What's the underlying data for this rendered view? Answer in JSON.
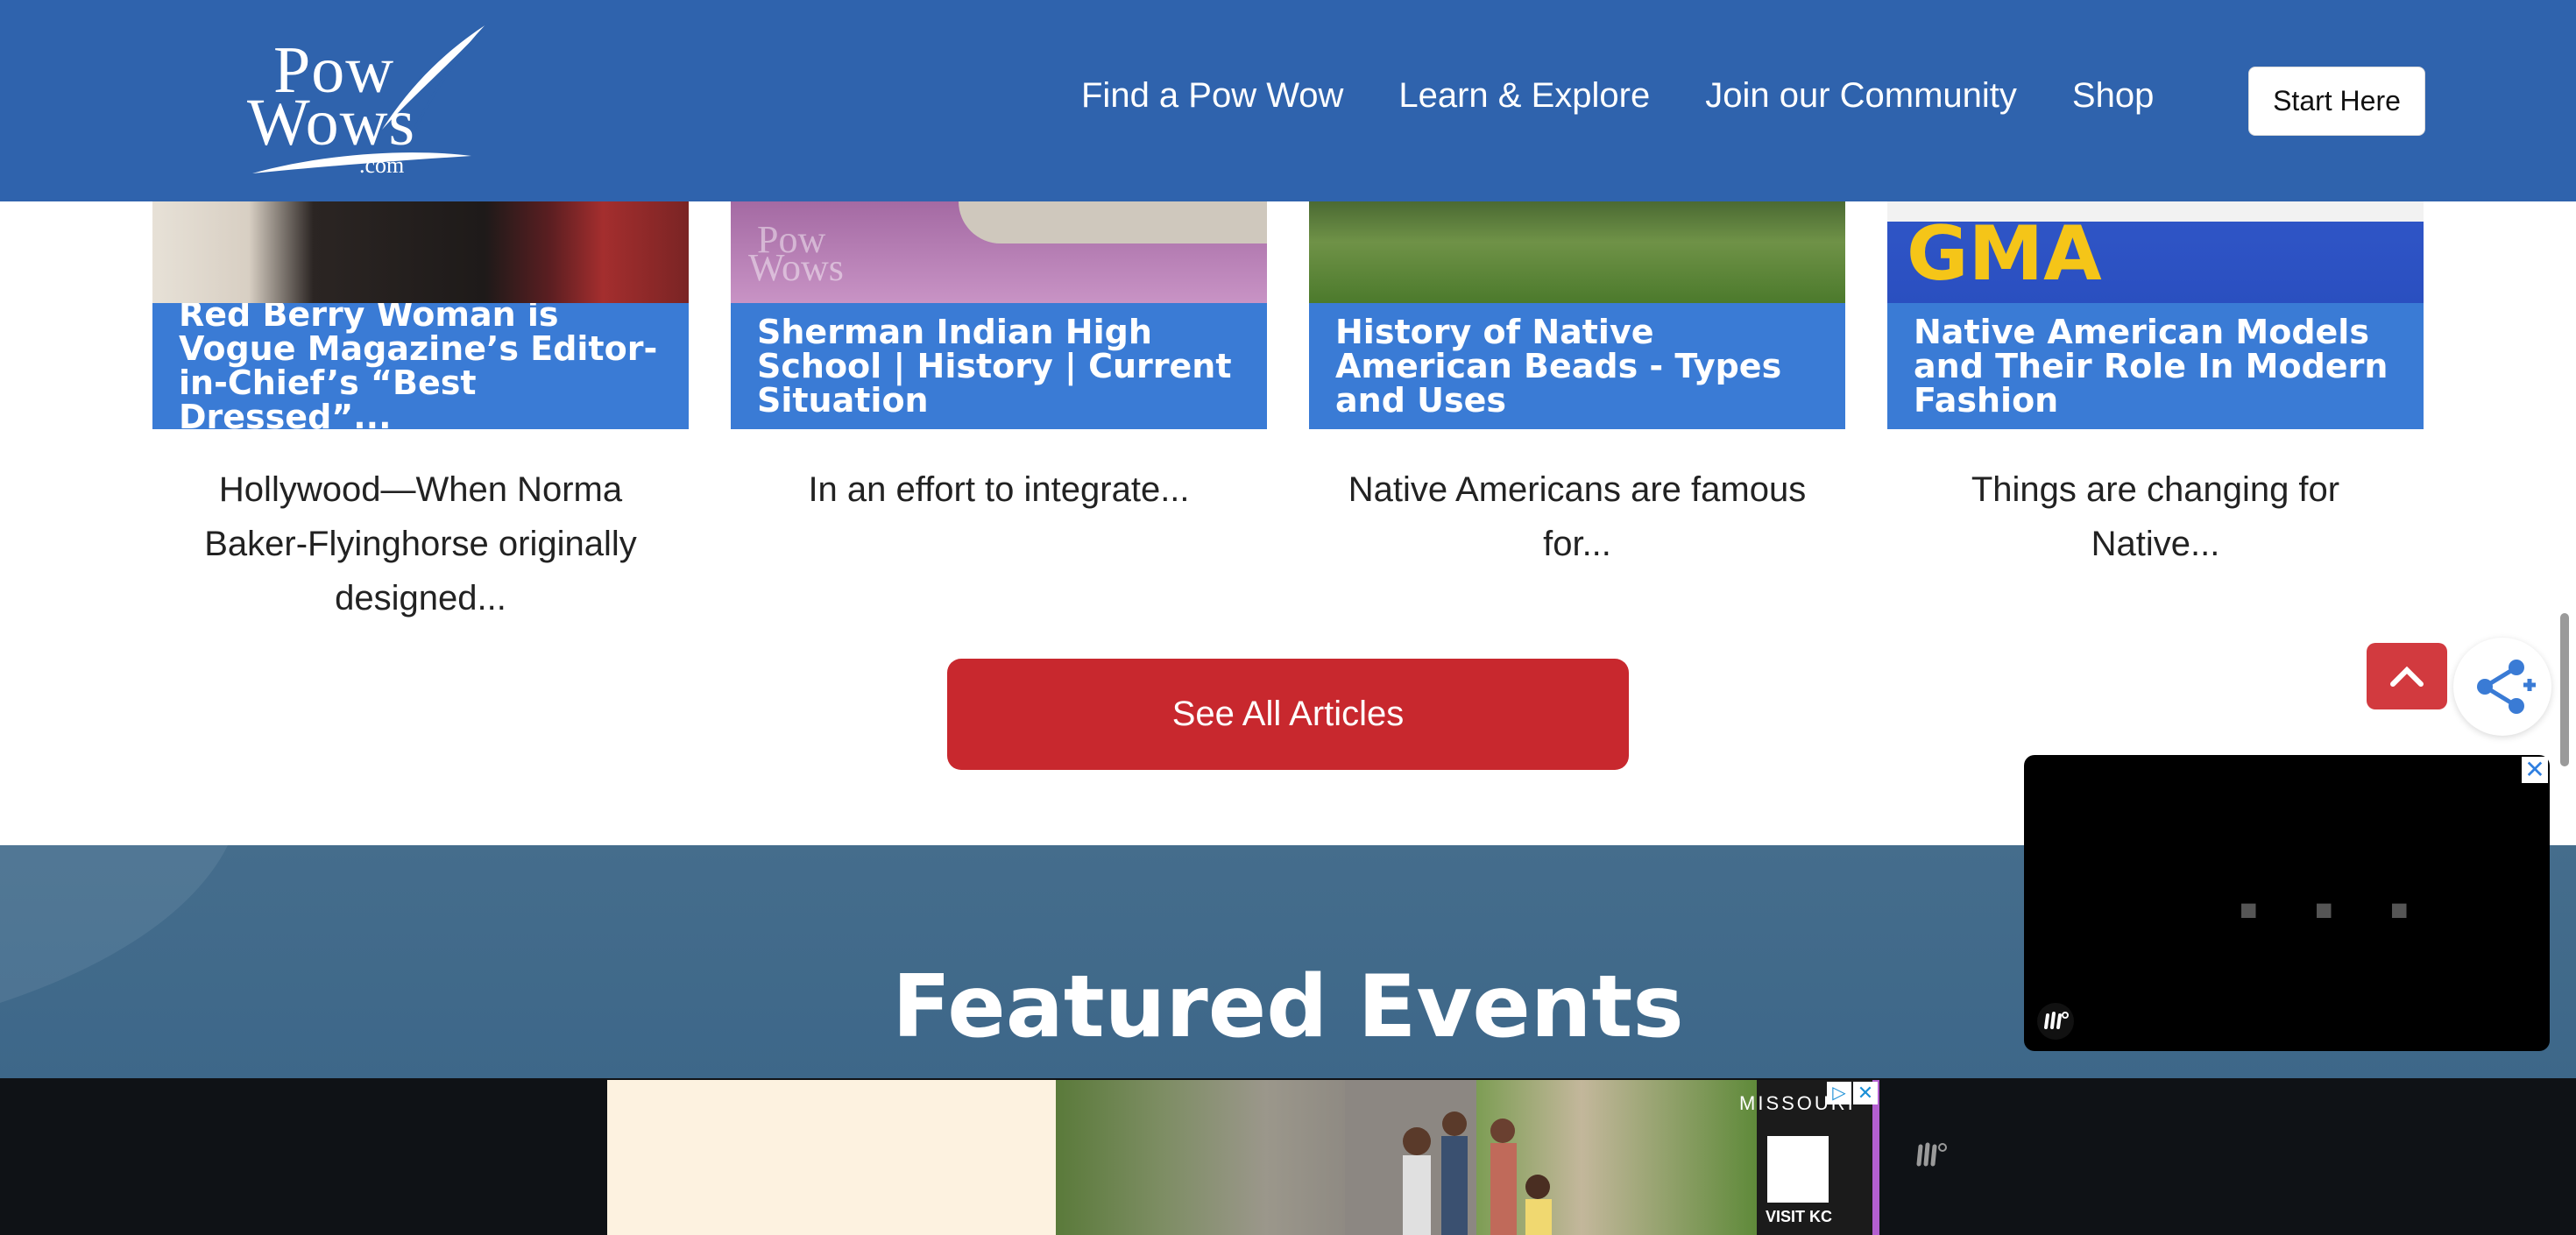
{
  "header": {
    "logo": {
      "line1": "Pow",
      "line2": "Wows",
      "line3": ".com"
    },
    "nav": [
      {
        "label": "Find a Pow Wow"
      },
      {
        "label": "Learn & Explore"
      },
      {
        "label": "Join our Community"
      },
      {
        "label": "Shop"
      }
    ],
    "start_label": "Start Here",
    "bg_color": "#2f63ad"
  },
  "articles": [
    {
      "title": "Red Berry Woman is Vogue Magazine’s Editor-in-Chief’s “Best Dressed”...",
      "excerpt": "Hollywood—When Norma Baker-Flyinghorse originally designed..."
    },
    {
      "title": "Sherman Indian High School | History | Current Situation",
      "excerpt": "In an effort to integrate..."
    },
    {
      "title": "History of Native American Beads - Types and Uses",
      "excerpt": "Native Americans are famous for..."
    },
    {
      "title": "Native American Models and Their Role In Modern Fashion",
      "excerpt": "Things are changing for Native..."
    }
  ],
  "card_images": {
    "img2_watermark_1": "Pow",
    "img2_watermark_2": "Wows",
    "img4_text": "GMA"
  },
  "see_all_label": "See All Articles",
  "featured_title": "Featured Events",
  "video": {
    "dots": "■ ■ ■",
    "close": "✕"
  },
  "ad": {
    "brand": "MISSOURI",
    "visit": "VISIT KC",
    "choices_icon": "▷",
    "close": "✕"
  },
  "colors": {
    "title_bar": "#3a7bd5",
    "see_all": "#c8282e",
    "scroll_top": "#d23a3f",
    "featured_bg": "#3d6789"
  }
}
